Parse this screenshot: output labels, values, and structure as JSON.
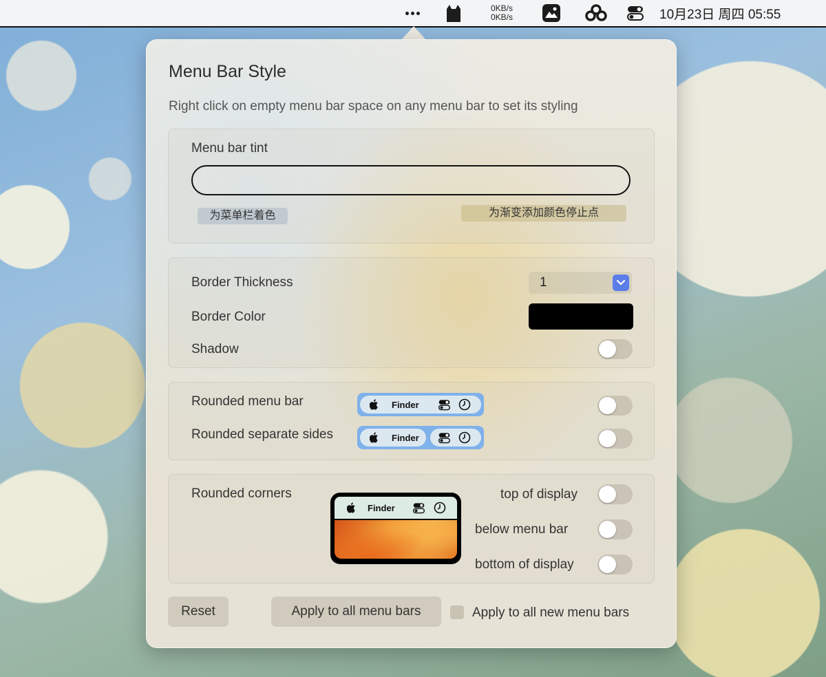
{
  "menubar": {
    "net_up": "0KB/s",
    "net_down": "0KB/s",
    "datetime": "10月23日 周四  05:55",
    "icons": [
      "more-dots-icon",
      "cat-icon",
      "photo-icon",
      "cloud-icon",
      "toggle-menu-icon"
    ]
  },
  "popover": {
    "title": "Menu Bar Style",
    "subtitle": "Right click on empty menu bar space on any menu bar to set its styling",
    "tint": {
      "label": "Menu bar tint",
      "color_chip": "为菜单栏着色",
      "gradient_stop_chip": "为渐变添加颜色停止点"
    },
    "border": {
      "thickness_label": "Border Thickness",
      "thickness_value": "1",
      "color_label": "Border Color",
      "color_value": "#000000",
      "shadow_label": "Shadow",
      "shadow_on": false
    },
    "rounding": {
      "rounded_menu_bar_label": "Rounded menu bar",
      "rounded_separate_sides_label": "Rounded separate sides",
      "preview_app": "Finder",
      "rounded_menu_bar_on": false,
      "rounded_separate_sides_on": false
    },
    "corners": {
      "label": "Rounded corners",
      "preview_app": "Finder",
      "top_label": "top of display",
      "below_label": "below menu bar",
      "bottom_label": "bottom of display",
      "top_on": false,
      "below_on": false,
      "bottom_on": false
    },
    "footer": {
      "reset_label": "Reset",
      "apply_all_label": "Apply to all menu bars",
      "apply_new_label": "Apply to all new menu bars",
      "apply_new_checked": false
    }
  },
  "colors": {
    "accent": "#5b7de8",
    "preview_bar": "#7fb1ea"
  }
}
